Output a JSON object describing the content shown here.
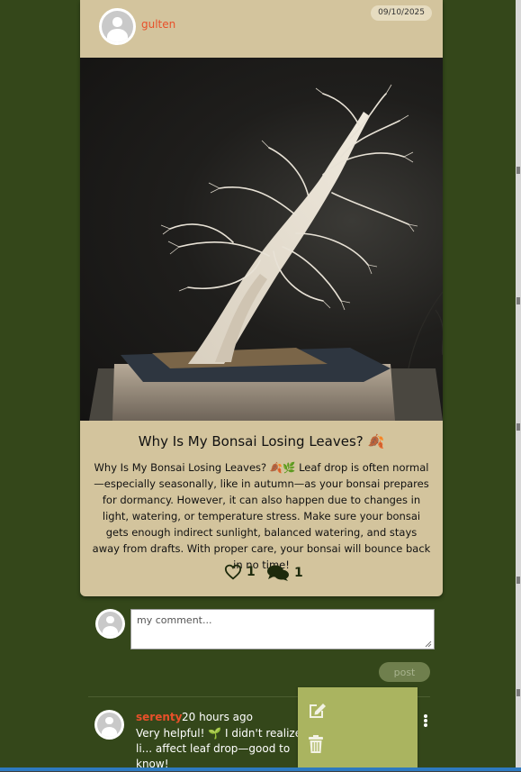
{
  "post": {
    "author": "gulten",
    "date": "09/10/2025",
    "title": "Why Is My Bonsai Losing Leaves? 🍂",
    "body": "Why Is My Bonsai Losing Leaves? 🍂🌿 Leaf drop is often normal—especially seasonally, like in autumn—as your bonsai prepares for dormancy. However, it can also happen due to changes in light, watering, or temperature stress. Make sure your bonsai gets enough indirect sunlight, balanced watering, and stays away from drafts. With proper care, your bonsai will bounce back in no time!",
    "likes": "1",
    "comments": "1",
    "image_icon": "bonsai-photo"
  },
  "composer": {
    "placeholder": "my comment...",
    "post_label": "post"
  },
  "comment": {
    "user": "serenty",
    "time": "20 hours ago",
    "text": "Very helpful! 🌱 I didn't realize li... affect leaf drop—good to know!"
  },
  "menu": {
    "edit_icon": "edit-icon",
    "delete_icon": "trash-icon"
  },
  "colors": {
    "background": "#34471a",
    "card": "#d3c49d",
    "accent": "#e8502a",
    "menu": "#aab460",
    "post_button": "#6f7f4d"
  }
}
